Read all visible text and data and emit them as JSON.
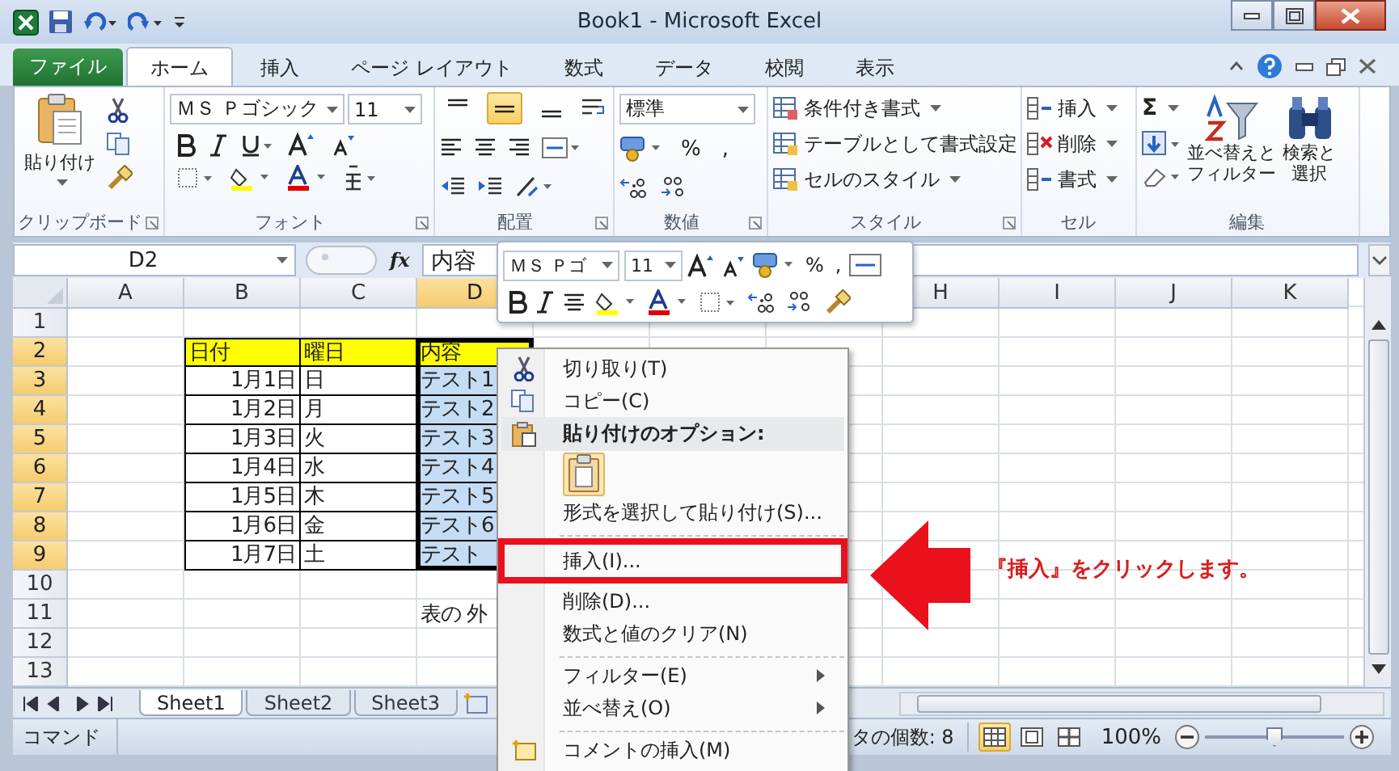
{
  "window": {
    "title": "Book1 - Microsoft Excel"
  },
  "ribbon_tabs": [
    {
      "label": "ファイル",
      "kind": "file",
      "selected": false
    },
    {
      "label": "ホーム",
      "kind": "tab",
      "selected": true
    },
    {
      "label": "挿入",
      "kind": "tab",
      "selected": false
    },
    {
      "label": "ページ レイアウト",
      "kind": "tab",
      "selected": false
    },
    {
      "label": "数式",
      "kind": "tab",
      "selected": false
    },
    {
      "label": "データ",
      "kind": "tab",
      "selected": false
    },
    {
      "label": "校閲",
      "kind": "tab",
      "selected": false
    },
    {
      "label": "表示",
      "kind": "tab",
      "selected": false
    }
  ],
  "ribbon_groups": [
    {
      "kind": "clipboard",
      "label": "クリップボード",
      "paste": "貼り付け"
    },
    {
      "kind": "font",
      "label": "フォント",
      "font_name": "ＭＳ Ｐゴシック",
      "font_size": "11"
    },
    {
      "kind": "alignment",
      "label": "配置",
      "valign": [
        {
          "selected": false
        },
        {
          "selected": true
        },
        {
          "selected": false
        }
      ]
    },
    {
      "kind": "number",
      "label": "数値",
      "format": "標準",
      "percent": "%",
      "comma": ","
    },
    {
      "kind": "styles",
      "label": "スタイル",
      "items": [
        "条件付き書式",
        "テーブルとして書式設定",
        "セルのスタイル"
      ]
    },
    {
      "kind": "cells",
      "label": "セル",
      "items": [
        "挿入",
        "削除",
        "書式"
      ]
    },
    {
      "kind": "editing",
      "label": "編集",
      "sum": "Σ",
      "sort": [
        "並べ替えと",
        "フィルター"
      ],
      "find": [
        "検索と",
        "選択"
      ]
    }
  ],
  "formula_bar": {
    "name_box": "D2",
    "fx": "fx",
    "value": "内容"
  },
  "columns": [
    {
      "label": "A",
      "selected": false
    },
    {
      "label": "B",
      "selected": false
    },
    {
      "label": "C",
      "selected": false
    },
    {
      "label": "D",
      "selected": true
    },
    {},
    {},
    {},
    {
      "label": "H",
      "selected": false
    },
    {
      "label": "I",
      "selected": false
    },
    {
      "label": "J",
      "selected": false
    },
    {
      "label": "K",
      "selected": false
    }
  ],
  "rows": [
    {
      "label": "1",
      "selected": false
    },
    {
      "label": "2",
      "selected": true
    },
    {
      "label": "3",
      "selected": true
    },
    {
      "label": "4",
      "selected": true
    },
    {
      "label": "5",
      "selected": true
    },
    {
      "label": "6",
      "selected": true
    },
    {
      "label": "7",
      "selected": true
    },
    {
      "label": "8",
      "selected": true
    },
    {
      "label": "9",
      "selected": true
    },
    {
      "label": "10",
      "selected": false
    },
    {
      "label": "11",
      "selected": false
    },
    {
      "label": "12",
      "selected": false
    },
    {
      "label": "13",
      "selected": false
    }
  ],
  "table": {
    "header": [
      "日付",
      "曜日",
      "内容"
    ],
    "rows": [
      [
        "1月1日",
        "日",
        "テスト1"
      ],
      [
        "1月2日",
        "月",
        "テスト2"
      ],
      [
        "1月3日",
        "火",
        "テスト3"
      ],
      [
        "1月4日",
        "水",
        "テスト4"
      ],
      [
        "1月5日",
        "木",
        "テスト5"
      ],
      [
        "1月6日",
        "金",
        "テスト6"
      ],
      [
        "1月7日",
        "土",
        "テスト"
      ]
    ]
  },
  "note": "表の 外",
  "sheet_tabs": [
    {
      "label": "Sheet1",
      "selected": true
    },
    {
      "label": "Sheet2",
      "selected": false
    },
    {
      "label": "Sheet3",
      "selected": false
    }
  ],
  "status_bar": {
    "mode": "コマンド",
    "summary": "タの個数: 8",
    "views": [
      {
        "selected": true
      },
      {
        "selected": false
      },
      {
        "selected": false
      }
    ],
    "zoom": "100%",
    "zoom_slider": {
      "level": 0.5
    }
  },
  "mini_toolbar": {
    "font_name": "ＭＳ Ｐゴ",
    "font_size": "11",
    "percent": "%",
    "comma": ","
  },
  "context_menu": {
    "items": [
      {
        "kind": "cut",
        "label": "切り取り(T)",
        "annotated": false
      },
      {
        "kind": "copy",
        "label": "コピー(C)",
        "annotated": false
      },
      {
        "kind": "heading",
        "label": "貼り付けのオプション:",
        "annotated": false
      },
      {
        "kind": "paste_button",
        "annotated": false
      },
      {
        "kind": "item",
        "label": "形式を選択して貼り付け(S)...",
        "annotated": false
      },
      {
        "kind": "separator",
        "annotated": false
      },
      {
        "kind": "item",
        "label": "挿入(I)...",
        "annotated": true
      },
      {
        "kind": "item",
        "label": "削除(D)...",
        "annotated": false
      },
      {
        "kind": "item",
        "label": "数式と値のクリア(N)",
        "annotated": false
      },
      {
        "kind": "separator",
        "annotated": false
      },
      {
        "kind": "submenu",
        "label": "フィルター(E)",
        "annotated": false
      },
      {
        "kind": "submenu",
        "label": "並べ替え(O)",
        "annotated": false
      },
      {
        "kind": "separator",
        "annotated": false
      },
      {
        "kind": "comment",
        "label": "コメントの挿入(M)",
        "annotated": false
      }
    ]
  },
  "annotation": {
    "text": "『挿入』をクリックします。"
  }
}
